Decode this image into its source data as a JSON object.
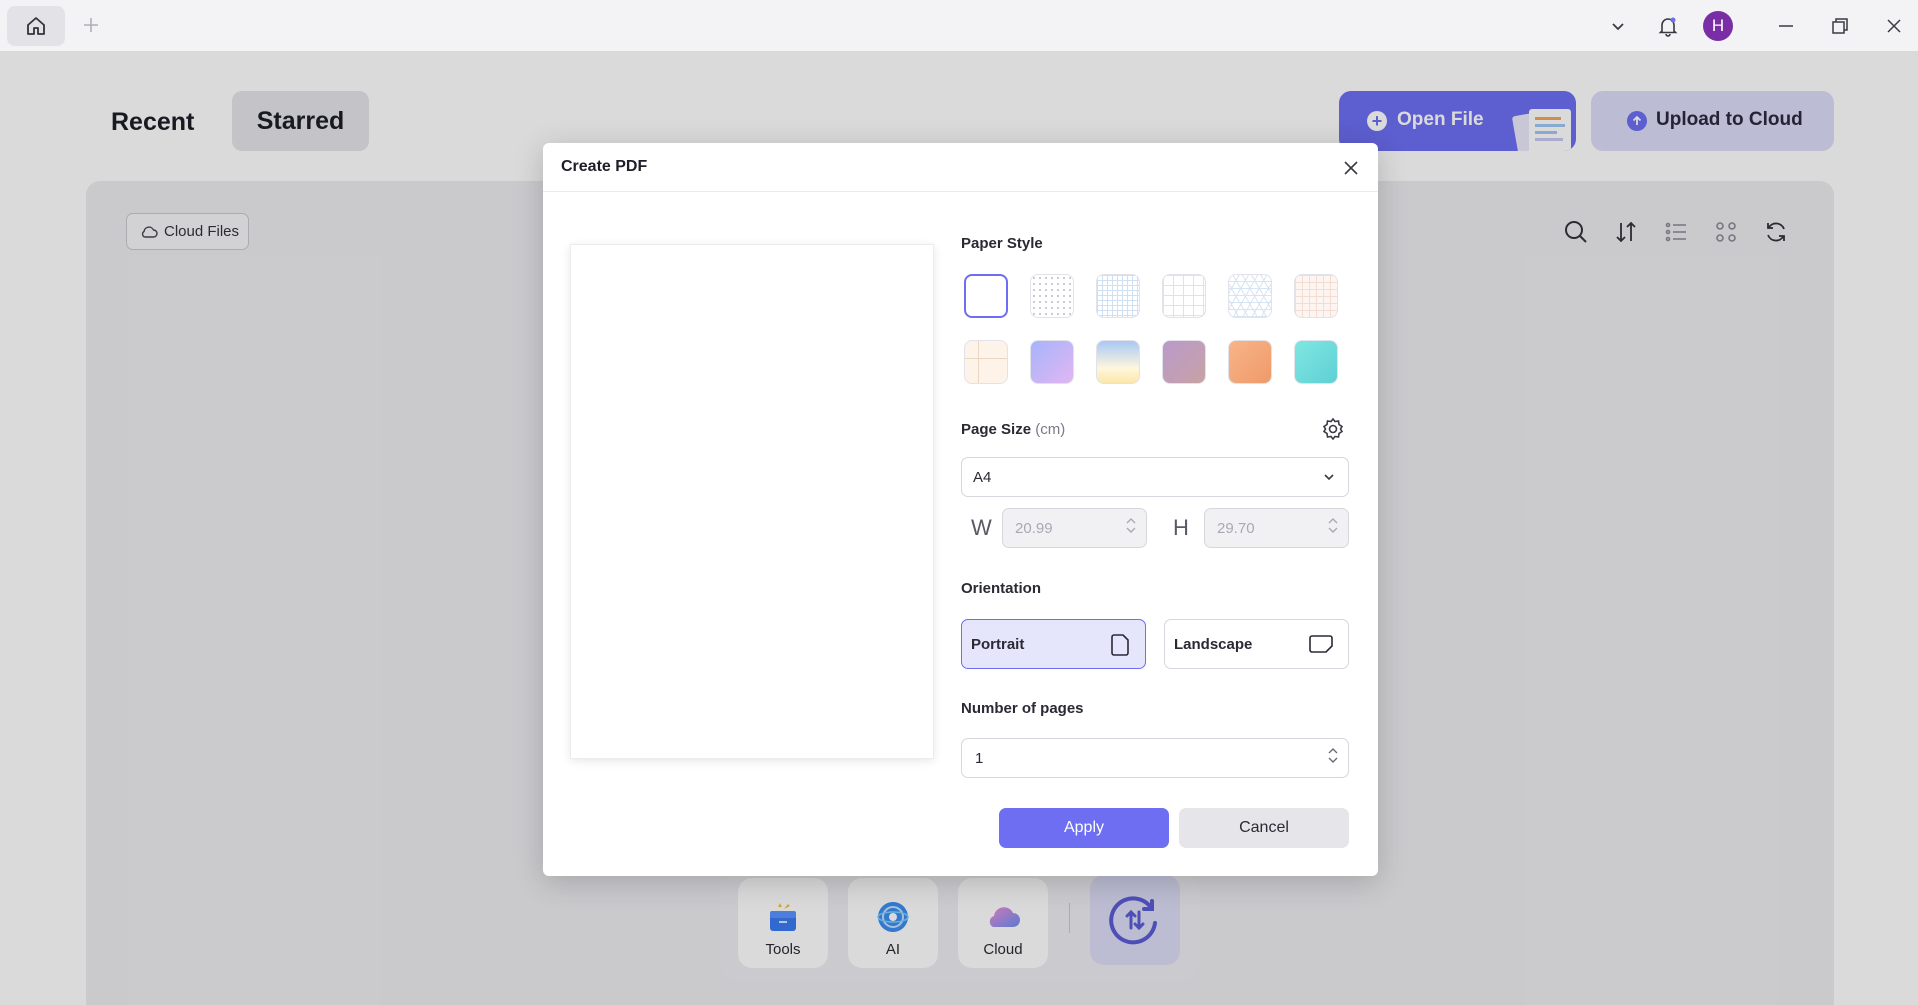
{
  "titlebar": {
    "icons": [
      "home-icon",
      "plus-icon",
      "chevron-down-icon",
      "bell-icon",
      "minimize-icon",
      "restore-icon",
      "close-icon"
    ],
    "avatar_initial": "H"
  },
  "home": {
    "tabs": [
      {
        "label": "Recent"
      },
      {
        "label": "Starred"
      }
    ],
    "open_file_label": "Open File",
    "upload_cloud_label": "Upload to Cloud",
    "cloud_files_label": "Cloud Files",
    "dock": [
      {
        "label": "Tools"
      },
      {
        "label": "AI"
      },
      {
        "label": "Cloud"
      }
    ]
  },
  "dialog": {
    "title": "Create PDF",
    "paper_style_label": "Paper Style",
    "page_size_label": "Page Size",
    "page_size_unit": "(cm)",
    "page_size_value": "A4",
    "width_letter": "W",
    "width_value": "20.99",
    "height_letter": "H",
    "height_value": "29.70",
    "orientation_label": "Orientation",
    "portrait_label": "Portrait",
    "landscape_label": "Landscape",
    "selected_orientation": "Portrait",
    "pages_label": "Number of pages",
    "pages_value": "1",
    "apply_label": "Apply",
    "cancel_label": "Cancel"
  },
  "colors": {
    "accent": "#6d6ef2",
    "accent_light": "#dcdcf8",
    "avatar": "#7a2ea6"
  }
}
